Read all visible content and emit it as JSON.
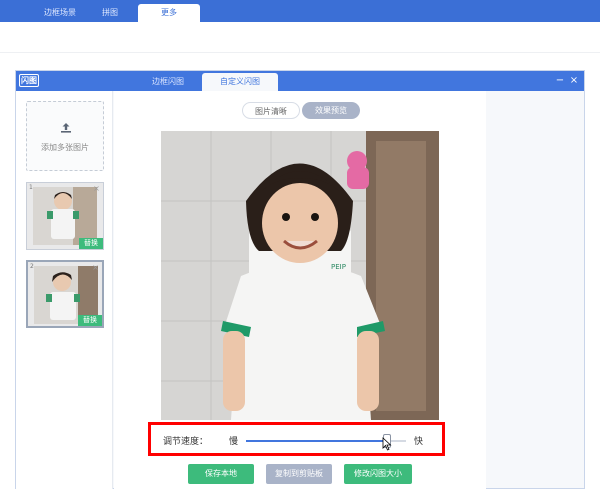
{
  "top_tabs": [
    {
      "label": "边框场景",
      "active": false
    },
    {
      "label": "拼图",
      "active": false
    },
    {
      "label": "更多",
      "active": true
    }
  ],
  "dialog": {
    "logo": "闪图",
    "tabs": [
      {
        "label": "边框闪图",
        "active": false
      },
      {
        "label": "自定义闪图",
        "active": true
      }
    ],
    "minimize": "−",
    "close": "×"
  },
  "left_panel": {
    "upload_label": "添加多张图片",
    "thumbnails": [
      {
        "index": "1",
        "badge": "替换",
        "close": "×",
        "selected": false
      },
      {
        "index": "2",
        "badge": "替换",
        "close": "×",
        "selected": true
      }
    ]
  },
  "mode_toggle": {
    "options": [
      "图片清晰",
      "效果预览"
    ],
    "selected": "效果预览"
  },
  "speed": {
    "label": "调节速度：",
    "slow": "慢",
    "fast": "快",
    "value_fraction": 0.88
  },
  "buttons": {
    "save": "保存本地",
    "copy": "复制到剪贴板",
    "resize": "修改闪图大小"
  },
  "colors": {
    "brand_blue": "#4176de",
    "accent_green": "#3dbb7c",
    "highlight_red": "#ff0000"
  }
}
